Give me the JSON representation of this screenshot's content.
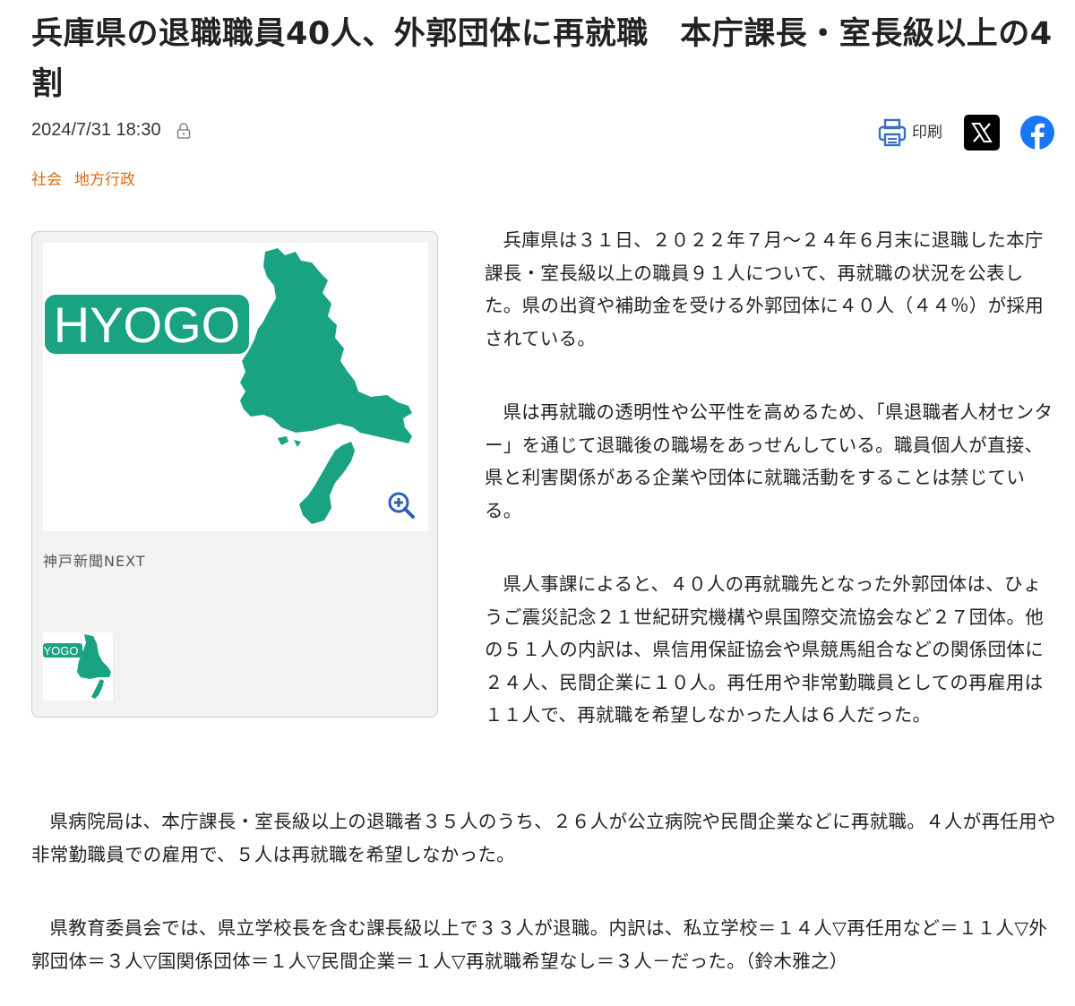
{
  "article": {
    "title": "兵庫県の退職職員40人、外郭団体に再就職　本庁課長・室長級以上の4割",
    "date": "2024/7/31 18:30",
    "tags": [
      "社会",
      "地方行政"
    ],
    "print_label": "印刷"
  },
  "photo": {
    "logo_text": "HYOGO",
    "thumb_logo_text": "YOGO",
    "caption": "神戸新聞NEXT"
  },
  "body": [
    "兵庫県は３１日、２０２２年７月～２４年６月末に退職した本庁課長・室長級以上の職員９１人について、再就職の状況を公表した。県の出資や補助金を受ける外郭団体に４０人（４４％）が採用されている。",
    "県は再就職の透明性や公平性を高めるため、「県退職者人材センター」を通じて退職後の職場をあっせんしている。職員個人が直接、県と利害関係がある企業や団体に就職活動をすることは禁じている。",
    "県人事課によると、４０人の再就職先となった外郭団体は、ひょうご震災記念２１世紀研究機構や県国際交流協会など２７団体。他の５１人の内訳は、県信用保証協会や県競馬組合などの関係団体に２４人、民間企業に１０人。再任用や非常勤職員としての再雇用は１１人で、再就職を希望しなかった人は６人だった。",
    "県病院局は、本庁課長・室長級以上の退職者３５人のうち、２６人が公立病院や民間企業などに再就職。４人が再任用や非常勤職員での雇用で、５人は再就職を希望しなかった。",
    "県教育委員会では、県立学校長を含む課長級以上で３３人が退職。内訳は、私立学校＝１４人▽再任用など＝１１人▽外郭団体＝３人▽国関係団体＝１人▽民間企業＝１人▽再就職希望なし＝３人－だった。（鈴木雅之）"
  ],
  "colors": {
    "map_green": "#1aa382",
    "tag_orange": "#d96d10",
    "facebook_blue": "#1877f2",
    "print_blue": "#3a6fc7"
  }
}
